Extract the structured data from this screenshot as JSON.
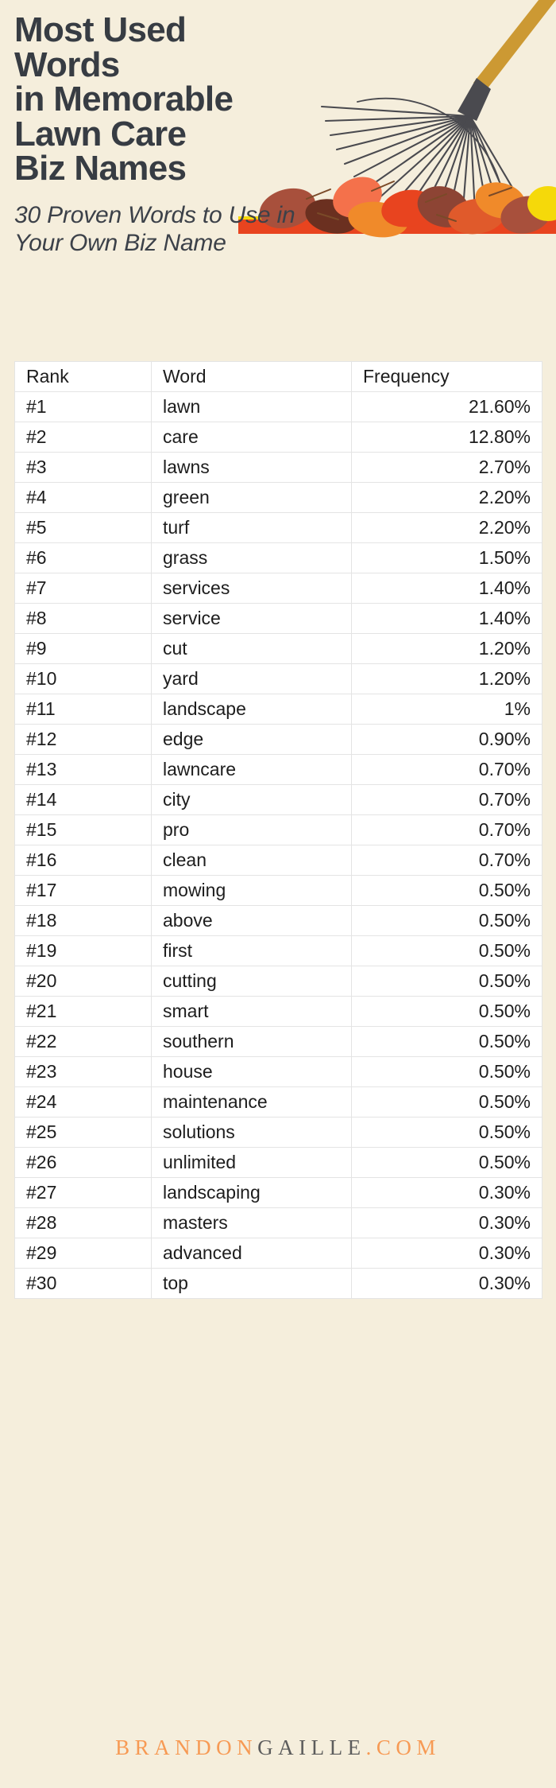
{
  "header": {
    "title": "Most Used Words\nin Memorable\nLawn Care\nBiz Names",
    "subtitle": "30 Proven Words to Use in\nYour Own Biz Name"
  },
  "illustration": {
    "name": "leaf-rake-with-autumn-leaves",
    "handle_color": "#cc9933",
    "head_color": "#4a4a4f",
    "leaf_colors": [
      "#a8503c",
      "#6b3020",
      "#f4714b",
      "#e8441f",
      "#f08a2a",
      "#f5d90a",
      "#8d4434",
      "#e05a2b"
    ]
  },
  "table": {
    "columns": [
      "Rank",
      "Word",
      "Frequency"
    ],
    "rows": [
      {
        "rank": "#1",
        "word": "lawn",
        "frequency": "21.60%"
      },
      {
        "rank": "#2",
        "word": "care",
        "frequency": "12.80%"
      },
      {
        "rank": "#3",
        "word": "lawns",
        "frequency": "2.70%"
      },
      {
        "rank": "#4",
        "word": "green",
        "frequency": "2.20%"
      },
      {
        "rank": "#5",
        "word": "turf",
        "frequency": "2.20%"
      },
      {
        "rank": "#6",
        "word": "grass",
        "frequency": "1.50%"
      },
      {
        "rank": "#7",
        "word": "services",
        "frequency": "1.40%"
      },
      {
        "rank": "#8",
        "word": "service",
        "frequency": "1.40%"
      },
      {
        "rank": "#9",
        "word": "cut",
        "frequency": "1.20%"
      },
      {
        "rank": "#10",
        "word": "yard",
        "frequency": "1.20%"
      },
      {
        "rank": "#11",
        "word": "landscape",
        "frequency": "1%"
      },
      {
        "rank": "#12",
        "word": "edge",
        "frequency": "0.90%"
      },
      {
        "rank": "#13",
        "word": "lawncare",
        "frequency": "0.70%"
      },
      {
        "rank": "#14",
        "word": "city",
        "frequency": "0.70%"
      },
      {
        "rank": "#15",
        "word": "pro",
        "frequency": "0.70%"
      },
      {
        "rank": "#16",
        "word": "clean",
        "frequency": "0.70%"
      },
      {
        "rank": "#17",
        "word": "mowing",
        "frequency": "0.50%"
      },
      {
        "rank": "#18",
        "word": "above",
        "frequency": "0.50%"
      },
      {
        "rank": "#19",
        "word": "first",
        "frequency": "0.50%"
      },
      {
        "rank": "#20",
        "word": "cutting",
        "frequency": "0.50%"
      },
      {
        "rank": "#21",
        "word": "smart",
        "frequency": "0.50%"
      },
      {
        "rank": "#22",
        "word": "southern",
        "frequency": "0.50%"
      },
      {
        "rank": "#23",
        "word": "house",
        "frequency": "0.50%"
      },
      {
        "rank": "#24",
        "word": "maintenance",
        "frequency": "0.50%"
      },
      {
        "rank": "#25",
        "word": "solutions",
        "frequency": "0.50%"
      },
      {
        "rank": "#26",
        "word": "unlimited",
        "frequency": "0.50%"
      },
      {
        "rank": "#27",
        "word": "landscaping",
        "frequency": "0.30%"
      },
      {
        "rank": "#28",
        "word": "masters",
        "frequency": "0.30%"
      },
      {
        "rank": "#29",
        "word": "advanced",
        "frequency": "0.30%"
      },
      {
        "rank": "#30",
        "word": "top",
        "frequency": "0.30%"
      }
    ]
  },
  "footer": {
    "brand_part1": "BRANDON",
    "brand_part2": "GAILLE",
    "brand_part3": ".COM",
    "color_orange": "#f79a54",
    "color_dark": "#5c5c5c"
  },
  "chart_data": {
    "type": "table",
    "title": "Most Used Words in Memorable Lawn Care Biz Names",
    "subtitle": "30 Proven Words to Use in Your Own Biz Name",
    "xlabel": "Word",
    "ylabel": "Frequency",
    "categories": [
      "lawn",
      "care",
      "lawns",
      "green",
      "turf",
      "grass",
      "services",
      "service",
      "cut",
      "yard",
      "landscape",
      "edge",
      "lawncare",
      "city",
      "pro",
      "clean",
      "mowing",
      "above",
      "first",
      "cutting",
      "smart",
      "southern",
      "house",
      "maintenance",
      "solutions",
      "unlimited",
      "landscaping",
      "masters",
      "advanced",
      "top"
    ],
    "values": [
      21.6,
      12.8,
      2.7,
      2.2,
      2.2,
      1.5,
      1.4,
      1.4,
      1.2,
      1.2,
      1.0,
      0.9,
      0.7,
      0.7,
      0.7,
      0.7,
      0.5,
      0.5,
      0.5,
      0.5,
      0.5,
      0.5,
      0.5,
      0.5,
      0.5,
      0.5,
      0.3,
      0.3,
      0.3,
      0.3
    ],
    "ranks": [
      "#1",
      "#2",
      "#3",
      "#4",
      "#5",
      "#6",
      "#7",
      "#8",
      "#9",
      "#10",
      "#11",
      "#12",
      "#13",
      "#14",
      "#15",
      "#16",
      "#17",
      "#18",
      "#19",
      "#20",
      "#21",
      "#22",
      "#23",
      "#24",
      "#25",
      "#26",
      "#27",
      "#28",
      "#29",
      "#30"
    ],
    "units": "percent",
    "ylim": [
      0,
      21.6
    ],
    "grid": false,
    "legend": "none"
  }
}
